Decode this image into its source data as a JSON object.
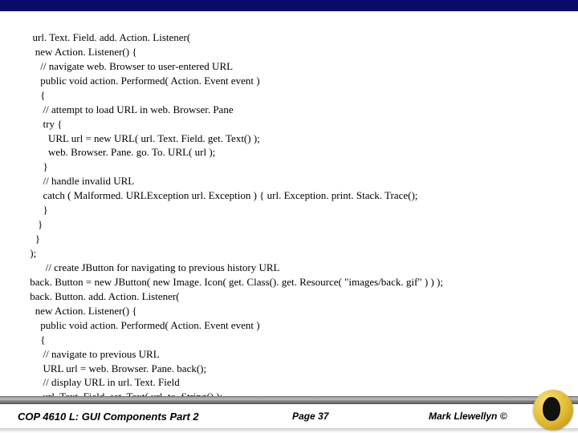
{
  "code": {
    "l1": "  url. Text. Field. add. Action. Listener(",
    "l2": "   new Action. Listener() {",
    "l3": "     // navigate web. Browser to user-entered URL",
    "l4": "     public void action. Performed( Action. Event event )",
    "l5": "     {",
    "l6": "      // attempt to load URL in web. Browser. Pane",
    "l7": "      try {",
    "l8": "        URL url = new URL( url. Text. Field. get. Text() );",
    "l9": "        web. Browser. Pane. go. To. URL( url );",
    "l10": "      }",
    "l11": "      // handle invalid URL",
    "l12": "      catch ( Malformed. URLException url. Exception ) { url. Exception. print. Stack. Trace();",
    "l13": "      }",
    "l14": "    }",
    "l15": "   }",
    "l16": " );",
    "l17": "       // create JButton for navigating to previous history URL",
    "l18": " back. Button = new JButton( new Image. Icon( get. Class(). get. Resource( \"images/back. gif\" ) ) );",
    "l19": " back. Button. add. Action. Listener(",
    "l20": "   new Action. Listener() {",
    "l21": "     public void action. Performed( Action. Event event )",
    "l22": "     {",
    "l23": "      // navigate to previous URL",
    "l24": "      URL url = web. Browser. Pane. back();",
    "l25": "      // display URL in url. Text. Field",
    "l26": "      url. Text. Field. set. Text( url. to. String() );",
    "l27": "    }",
    "l28": "   }     );"
  },
  "footer": {
    "left": "COP 4610 L: GUI Components Part 2",
    "mid": "Page 37",
    "right": "Mark Llewellyn ©"
  }
}
